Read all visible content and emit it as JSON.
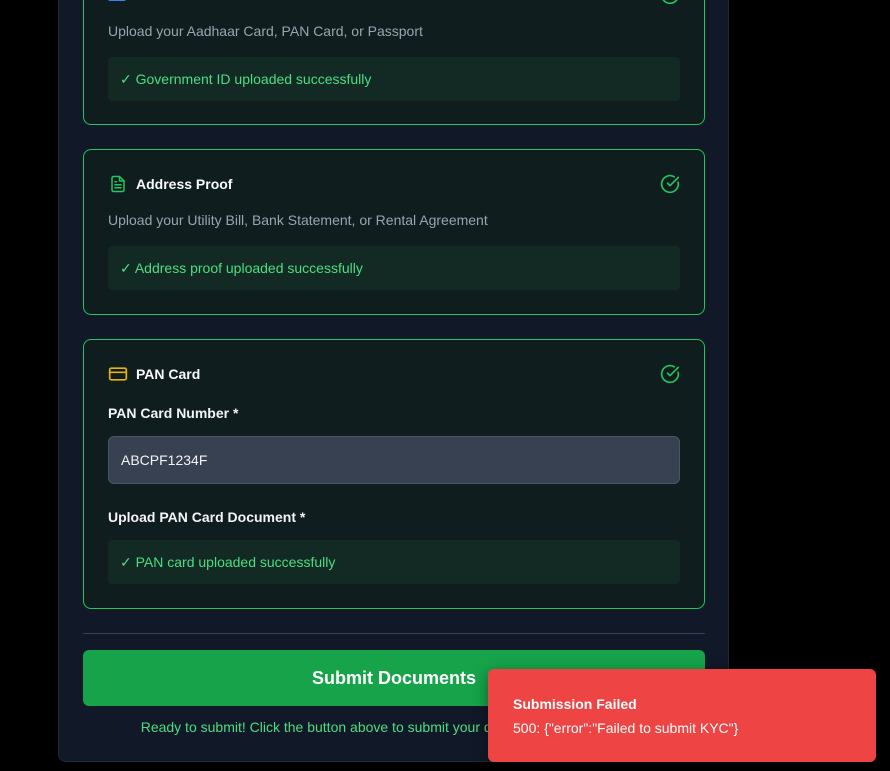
{
  "government_id": {
    "description": "Upload your Aadhaar Card, PAN Card, or Passport",
    "status": "✓ Government ID uploaded successfully"
  },
  "address_proof": {
    "title": "Address Proof",
    "description": "Upload your Utility Bill, Bank Statement, or Rental Agreement",
    "status": "✓ Address proof uploaded successfully"
  },
  "pan_card": {
    "title": "PAN Card",
    "number_label": "PAN Card Number *",
    "number_value": "ABCPF1234F",
    "document_label": "Upload PAN Card Document *",
    "status": "✓ PAN card uploaded successfully"
  },
  "submit_label": "Submit Documents",
  "ready_text": "Ready to submit! Click the button above to submit your documents for verification.",
  "toast": {
    "title": "Submission Failed",
    "message": "500: {\"error\":\"Failed to submit KYC\"}"
  },
  "colors": {
    "success": "#22c55e",
    "primary_button": "#16a34a",
    "error_toast": "#ef4444",
    "pan_icon": "#eab308"
  }
}
